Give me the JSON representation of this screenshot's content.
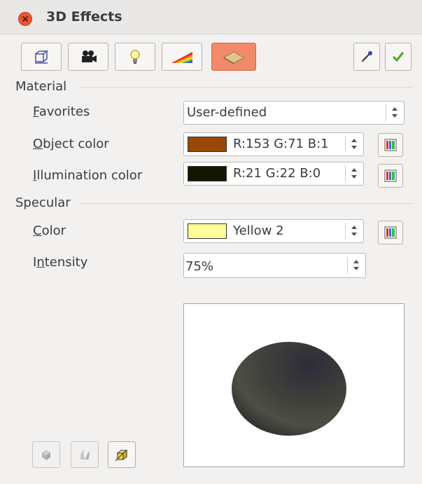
{
  "window": {
    "title": "3D Effects"
  },
  "toolbar": {
    "tabs": [
      {
        "name": "geometry",
        "icon": "geometry-cube-icon",
        "selected": false
      },
      {
        "name": "shading",
        "icon": "camera-icon",
        "selected": false
      },
      {
        "name": "illumination",
        "icon": "lightbulb-icon",
        "selected": false
      },
      {
        "name": "textures",
        "icon": "rainbow-texture-icon",
        "selected": false
      },
      {
        "name": "material",
        "icon": "material-plate-icon",
        "selected": true
      }
    ],
    "right_buttons": [
      {
        "name": "assign",
        "icon": "eyedropper-icon"
      },
      {
        "name": "apply",
        "icon": "checkmark-icon"
      }
    ]
  },
  "material": {
    "heading": "Material",
    "favorites": {
      "label_mnemonic": "F",
      "label_rest": "avorites",
      "value": "User-defined"
    },
    "object_color": {
      "label_mnemonic": "O",
      "label_rest": "bject color",
      "value": "R:153 G:71 B:1",
      "swatch": "#994701"
    },
    "illumination_color": {
      "label_mnemonic": "I",
      "label_rest": "llumination color",
      "value": "R:21 G:22 B:0",
      "swatch": "#151600"
    }
  },
  "specular": {
    "heading": "Specular",
    "color": {
      "label_mnemonic": "C",
      "label_rest": "olor",
      "value": "Yellow 2",
      "swatch": "#ffff99"
    },
    "intensity": {
      "label_start": "I",
      "label_mnemonic": "n",
      "label_rest": "tensity",
      "value": "75%"
    }
  },
  "icons": {
    "color_palette": "color-palette-icon",
    "preview_object": "sphere-preview",
    "bottom": [
      "3d-object-icon",
      "3d-rotation-icon",
      "perspective-cube-icon"
    ]
  },
  "colors": {
    "accent_selected": "#f28a6a",
    "close_button": "#ee5530"
  }
}
